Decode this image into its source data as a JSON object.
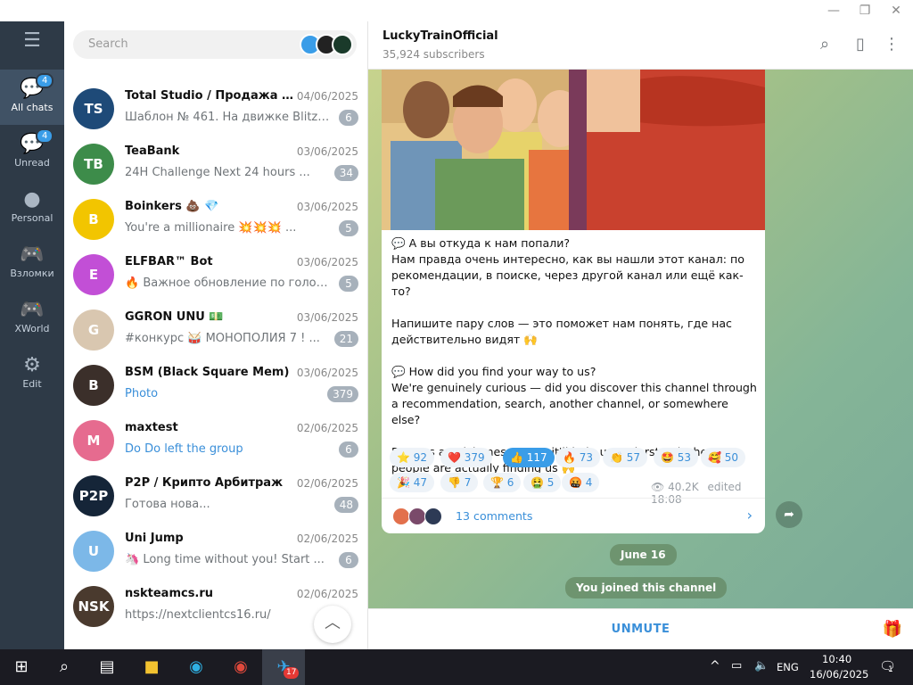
{
  "window": {
    "minimize": "—",
    "maximize": "❐",
    "close": "✕"
  },
  "rail": {
    "menu_icon": "hamburger-icon",
    "items": [
      {
        "label": "All chats",
        "badge": "4"
      },
      {
        "label": "Unread",
        "badge": "4"
      },
      {
        "label": "Personal"
      },
      {
        "label": "Взломки"
      },
      {
        "label": "XWorld"
      },
      {
        "label": "Edit"
      }
    ]
  },
  "search": {
    "placeholder": "Search"
  },
  "chats": [
    {
      "name": "Total Studio / Продажа и ...",
      "date": "04/06/2025",
      "preview": "Шаблон № 461. На движке Blitz-Sc...",
      "count": "6",
      "avatar": "TS",
      "color": "#1e4a78"
    },
    {
      "name": "TeaBank",
      "date": "03/06/2025",
      "preview": "24H Challenge  Next 24 hours ...",
      "count": "34",
      "avatar": "TB",
      "color": "#3d8c4a"
    },
    {
      "name": "Boinkers 💩 💎",
      "date": "03/06/2025",
      "preview": "You're a millionaire  💥💥💥 ...",
      "count": "5",
      "avatar": "B",
      "color": "#f2c500"
    },
    {
      "name": "ELFBAR™ Bot",
      "date": "03/06/2025",
      "preview": "🔥 Важное обновление по голосова...",
      "count": "5",
      "avatar": "E",
      "color": "#c24fd6"
    },
    {
      "name": "GGRON UNU 💵",
      "date": "03/06/2025",
      "preview": "#конкурс 🥁 МОНОПОЛИЯ 7 ! ...",
      "count": "21",
      "avatar": "G",
      "color": "#d9c7b0"
    },
    {
      "name": "BSM (Black Square Mem)",
      "date": "03/06/2025",
      "preview": "Photo",
      "count": "379",
      "avatar": "B",
      "color": "#3b2f2a",
      "link": true
    },
    {
      "name": "maxtest",
      "date": "02/06/2025",
      "preview": "Do Do left the group",
      "count": "6",
      "avatar": "M",
      "color": "#e66b8f",
      "link": true
    },
    {
      "name": "P2P / Крипто Арбитраж",
      "date": "02/06/2025",
      "preview": "Готова нова...",
      "count": "48",
      "avatar": "P2P",
      "color": "#152538"
    },
    {
      "name": "Uni Jump",
      "date": "02/06/2025",
      "preview": "🦄 Long time without you!  Start ...",
      "count": "6",
      "avatar": "U",
      "color": "#7cb8e8"
    },
    {
      "name": "nskteamcs.ru",
      "date": "02/06/2025",
      "preview": "https://nextclientcs16.ru/",
      "count": "",
      "avatar": "NSK",
      "color": "#4a3a2e"
    }
  ],
  "channel": {
    "title": "LuckyTrainOfficial",
    "subscribers": "35,924 subscribers"
  },
  "post": {
    "lines": [
      "💬 А вы откуда к нам попали?",
      "Нам правда очень интересно, как вы нашли этот канал: по рекомендации, в поиске, через другой канал или ещё как-то?",
      "",
      "Напишите пару слов — это поможет нам понять, где нас действительно видят 🙌",
      "",
      "💬 How did you find your way to us?",
      "We're genuinely curious — did you discover this channel through a recommendation, search, another channel, or somewhere else?",
      "",
      "Drop us a quick message — it'll help us understand where people are actually finding us 🙌"
    ],
    "reactions": [
      {
        "emoji": "⭐",
        "count": "92"
      },
      {
        "emoji": "❤️",
        "count": "379"
      },
      {
        "emoji": "👍",
        "count": "117",
        "mine": true
      },
      {
        "emoji": "🔥",
        "count": "73"
      },
      {
        "emoji": "👏",
        "count": "57"
      },
      {
        "emoji": "🤩",
        "count": "53"
      },
      {
        "emoji": "🥰",
        "count": "50"
      },
      {
        "emoji": "🎉",
        "count": "47"
      },
      {
        "emoji": "👎",
        "count": "7"
      },
      {
        "emoji": "🏆",
        "count": "6"
      },
      {
        "emoji": "🤮",
        "count": "5"
      },
      {
        "emoji": "🤬",
        "count": "4"
      }
    ],
    "views": "40.2K",
    "edited": "edited 18:08",
    "comments": "13 comments"
  },
  "date_pill": "June 16",
  "service_msg": "You joined this channel",
  "unmute": "UNMUTE",
  "taskbar": {
    "telegram_badge": "17",
    "lang": "ENG",
    "time": "10:40",
    "date": "16/06/2025",
    "notif": "1"
  }
}
